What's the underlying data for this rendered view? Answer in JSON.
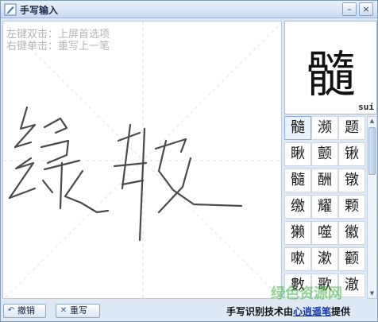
{
  "window": {
    "title": "手写输入",
    "minimize_icon": "minimize-icon",
    "close_icon": "close-icon"
  },
  "canvas": {
    "hint_left": "左键双击：上屏首选项",
    "hint_right": "右键单击：重写上一笔"
  },
  "preview": {
    "char": "髓",
    "pinyin": "suí"
  },
  "candidates": [
    "髓",
    "濒",
    "题",
    "瞅",
    "颤",
    "锹",
    "髓",
    "酬",
    "镦",
    "缴",
    "耀",
    "颗",
    "獭",
    "噬",
    "徽",
    "嗽",
    "漱",
    "颧",
    "數",
    "歌",
    "澈"
  ],
  "toolbar": {
    "undo_label": "撤销",
    "rewrite_label": "重写"
  },
  "credit": {
    "prefix": "手写识别技术由",
    "brand": "心逍遥笔",
    "suffix": "提供"
  },
  "watermark": "绿色资源网"
}
